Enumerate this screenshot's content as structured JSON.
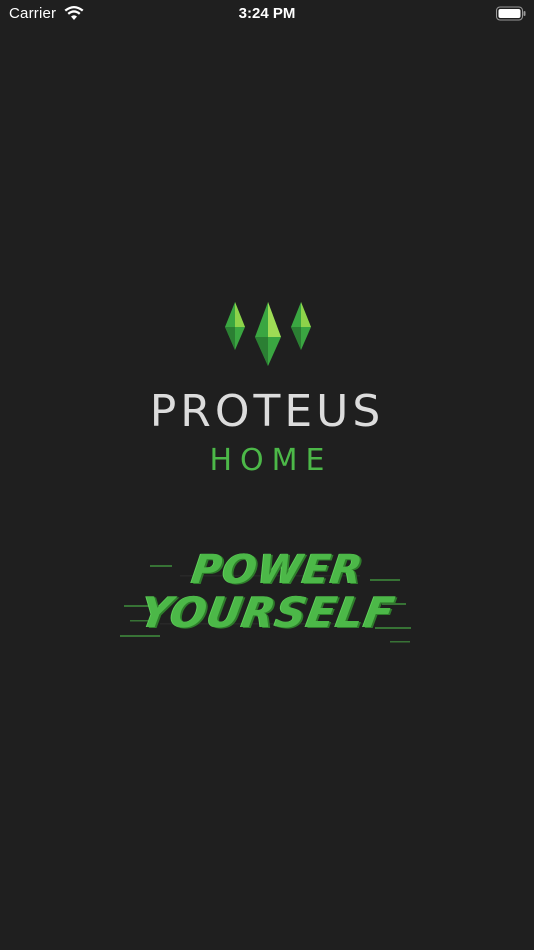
{
  "status_bar": {
    "carrier": "Carrier",
    "time": "3:24 PM"
  },
  "logo": {
    "icon": "crystal-logo-icon",
    "name": "PROTEUS",
    "sub": "HOME"
  },
  "tagline": {
    "line1": "POWER",
    "line2": "YOURSELF"
  },
  "colors": {
    "background": "#1f1f1f",
    "brand_green": "#4cb848",
    "brand_text": "#dcdcdc"
  }
}
